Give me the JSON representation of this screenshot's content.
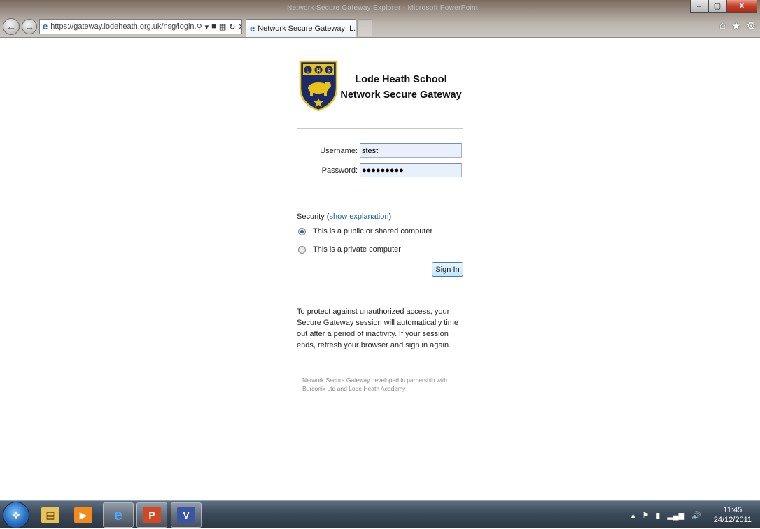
{
  "browser": {
    "window_title_faint": "Network Secure Gateway Explorer - Microsoft PowerPoint",
    "url": "https://gateway.lodeheath.org.uk/nsg/login.",
    "tab_title": "Network Secure Gateway: L...",
    "window_buttons": {
      "minimize": "–",
      "restore": "▢",
      "close": "X"
    },
    "right_icons": [
      "home-icon",
      "star-icon",
      "gear-icon"
    ]
  },
  "header": {
    "line1": "Lode Heath School",
    "line2": "Network Secure Gateway",
    "logo_letters": "LHS"
  },
  "form": {
    "username_label": "Username:",
    "username_value": "stest",
    "password_label": "Password:",
    "password_value": "●●●●●●●●●",
    "security_label": "Security (",
    "security_link": "show explanation",
    "security_close": ")",
    "radio_public": "This is a public or shared computer",
    "radio_private": "This is a private computer",
    "selected_option": "public",
    "signin_label": "Sign In"
  },
  "notice": "To protect against unauthorized access, your Secure Gateway session will automatically time out after a period of inactivity. If your session ends, refresh your browser and sign in again.",
  "footer": "Network Secure Gateway developed in parnership with Burconix Ltd and Lode Heath Academy",
  "taskbar": {
    "apps": [
      "explorer-icon",
      "media-player-icon",
      "internet-explorer-icon",
      "powerpoint-icon",
      "visio-icon"
    ],
    "time": "11:45",
    "date": "24/12/2011"
  },
  "colors": {
    "link": "#1c5aa6",
    "input_bg": "#e8f1fb",
    "signin_border": "#3c7fb1",
    "logo_navy": "#1b2a6b",
    "logo_gold": "#e8c21a"
  }
}
